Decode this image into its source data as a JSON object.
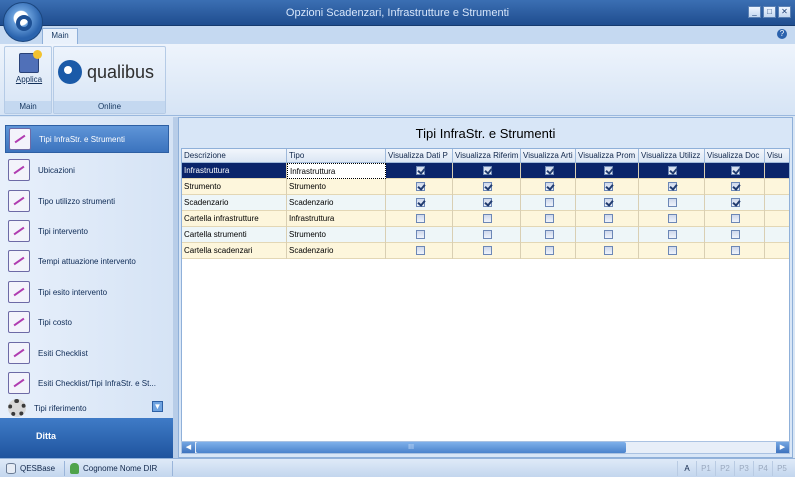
{
  "window": {
    "title": "Opzioni Scadenzari, Infrastrutture e Strumenti",
    "min": "_",
    "max": "□",
    "close": "✕"
  },
  "ribbon": {
    "tab": "Main",
    "help": "?",
    "apply_label": "Applica",
    "group_main": "Main",
    "group_online": "Online",
    "logo_text": "qualibus"
  },
  "sidebar": {
    "items": [
      {
        "label": "Tipi InfraStr. e Strumenti",
        "selected": true
      },
      {
        "label": "Ubicazioni"
      },
      {
        "label": "Tipo utilizzo strumenti"
      },
      {
        "label": "Tipi intervento"
      },
      {
        "label": "Tempi attuazione intervento"
      },
      {
        "label": "Tipi esito intervento"
      },
      {
        "label": "Tipi costo"
      },
      {
        "label": "Esiti Checklist"
      },
      {
        "label": "Esiti Checklist/Tipi InfraStr. e St..."
      },
      {
        "label": "Tipi riferimento"
      }
    ],
    "bottom": "Ditta"
  },
  "content": {
    "title": "Tipi InfraStr. e Strumenti",
    "columns": [
      "Descrizione",
      "Tipo",
      "Visualizza Dati P",
      "Visualizza Riferim",
      "Visualizza Arti",
      "Visualizza Prom",
      "Visualizza Utilizz",
      "Visualizza Doc",
      "Visu"
    ],
    "rows": [
      {
        "descrizione": "Infrastruttura",
        "tipo": "Infrastruttura",
        "checks": [
          true,
          true,
          true,
          true,
          true,
          true
        ]
      },
      {
        "descrizione": "Strumento",
        "tipo": "Strumento",
        "checks": [
          true,
          true,
          true,
          true,
          true,
          true
        ]
      },
      {
        "descrizione": "Scadenzario",
        "tipo": "Scadenzario",
        "checks": [
          true,
          true,
          false,
          true,
          false,
          true
        ]
      },
      {
        "descrizione": "Cartella infrastrutture",
        "tipo": "Infrastruttura",
        "checks": [
          false,
          false,
          false,
          false,
          false,
          false
        ]
      },
      {
        "descrizione": "Cartella strumenti",
        "tipo": "Strumento",
        "checks": [
          false,
          false,
          false,
          false,
          false,
          false
        ]
      },
      {
        "descrizione": "Cartella scadenzari",
        "tipo": "Scadenzario",
        "checks": [
          false,
          false,
          false,
          false,
          false,
          false
        ]
      }
    ],
    "scroll_left": "◀",
    "scroll_right": "▶",
    "scroll_grip": "III"
  },
  "statusbar": {
    "db": "QESBase",
    "user": "Cognome Nome DIR",
    "keys": [
      "A",
      "P1",
      "P2",
      "P3",
      "P4",
      "P5"
    ]
  },
  "colors": {
    "selected_row": "#0a246a",
    "row_alt": "#fdf6dc",
    "row": "#eef6f8",
    "accent": "#3b73be"
  }
}
